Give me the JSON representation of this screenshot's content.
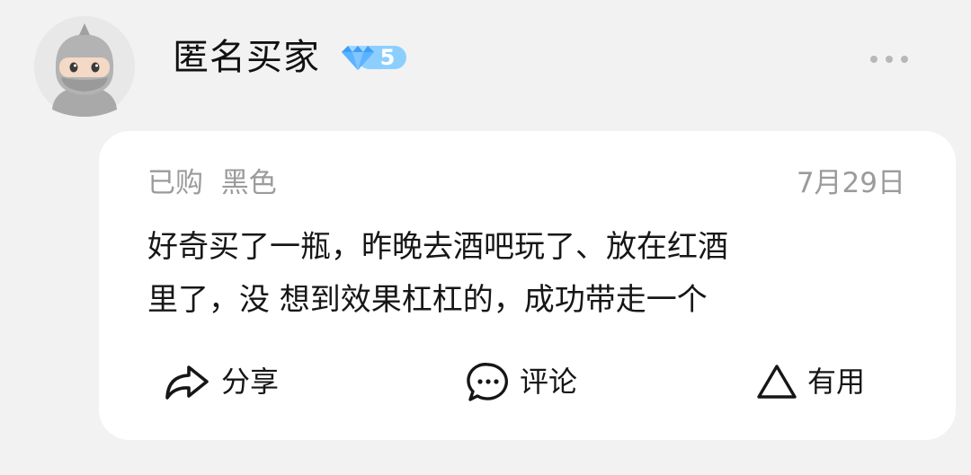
{
  "user": {
    "name": "匿名买家",
    "level": "5",
    "avatar_icon": "ninja-avatar-icon",
    "badge_icon": "diamond-icon",
    "badge_color": "#5cb3ff"
  },
  "more_icon": "more-dots-icon",
  "review": {
    "meta": "已购  黑色",
    "date": "7月29日",
    "text_lines": [
      "好奇买了一瓶，昨晚去酒吧玩了、放在红酒",
      "里了，没 想到效果杠杠的，成功带走一个"
    ]
  },
  "actions": {
    "share": {
      "label": "分享",
      "icon": "share-arrow-icon"
    },
    "comment": {
      "label": "评论",
      "icon": "comment-bubble-icon"
    },
    "useful": {
      "label": "有用",
      "icon": "triangle-icon"
    }
  }
}
